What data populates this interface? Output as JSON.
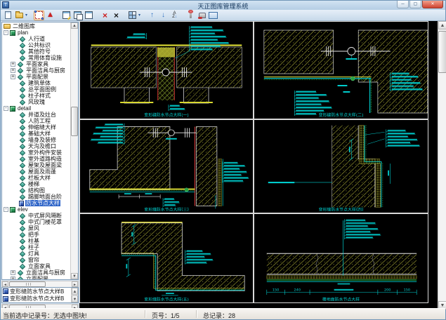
{
  "window": {
    "title": "天正图库管理系统"
  },
  "toolbar": {
    "items": [
      {
        "name": "new-library-button",
        "type": "page"
      },
      {
        "name": "open-library-button",
        "type": "folder",
        "dropdown": true
      },
      {
        "name": "select-mode-button",
        "type": "select",
        "active": true,
        "gap": true
      },
      {
        "name": "multi-view-button",
        "type": "pyramid"
      },
      {
        "name": "rename-block-button",
        "type": "panel-edit",
        "gap": true
      },
      {
        "name": "copy-block-button",
        "type": "panel-copy"
      },
      {
        "name": "move-block-button",
        "type": "panel-move"
      },
      {
        "name": "delete-record-button",
        "type": "delete-red",
        "gap": true
      },
      {
        "name": "delete-category-button",
        "type": "delete-black"
      },
      {
        "name": "layout-grid-button",
        "type": "grid",
        "dropdown": true,
        "gap": true
      },
      {
        "name": "page-up-button",
        "type": "arrow-up",
        "glyph": "↑",
        "gap": true
      },
      {
        "name": "page-down-button",
        "type": "arrow-down",
        "glyph": "↓"
      },
      {
        "name": "sort-button",
        "type": "sort"
      },
      {
        "name": "pin-button",
        "type": "pin",
        "gap": true
      },
      {
        "name": "stamp-button",
        "type": "stamp"
      },
      {
        "name": "view-panel-button",
        "type": "image"
      }
    ]
  },
  "sidebar": {
    "tree": [
      {
        "label": "二维图库",
        "kind": "root"
      },
      {
        "label": "plan",
        "kind": "group"
      },
      {
        "label": "人行道",
        "kind": "leaf"
      },
      {
        "label": "公共标识",
        "kind": "leaf"
      },
      {
        "label": "其他符号",
        "kind": "leaf"
      },
      {
        "label": "常用体育设施",
        "kind": "leaf"
      },
      {
        "label": "平面家具",
        "kind": "leafx"
      },
      {
        "label": "平面洁具与厨房",
        "kind": "leafx"
      },
      {
        "label": "平面配景",
        "kind": "leafx"
      },
      {
        "label": "建筑单体",
        "kind": "leaf"
      },
      {
        "label": "总平面图例",
        "kind": "leaf"
      },
      {
        "label": "柱子样式",
        "kind": "leaf"
      },
      {
        "label": "风玫瑰",
        "kind": "leaf"
      },
      {
        "label": "detail",
        "kind": "group"
      },
      {
        "label": "井道及灶台",
        "kind": "leaf"
      },
      {
        "label": "人防工程",
        "kind": "leaf"
      },
      {
        "label": "伸缩缝大样",
        "kind": "leaf"
      },
      {
        "label": "基础大样",
        "kind": "leaf"
      },
      {
        "label": "墙身及装修",
        "kind": "leaf"
      },
      {
        "label": "天沟及檐口",
        "kind": "leaf"
      },
      {
        "label": "室外构件安装",
        "kind": "leaf"
      },
      {
        "label": "室外道路构造",
        "kind": "leaf"
      },
      {
        "label": "屋架及屋面梁",
        "kind": "leaf"
      },
      {
        "label": "屋面及雨蓬",
        "kind": "leaf"
      },
      {
        "label": "栏板大样",
        "kind": "leaf"
      },
      {
        "label": "楼梯",
        "kind": "leaf"
      },
      {
        "label": "结构图",
        "kind": "leaf"
      },
      {
        "label": "踢脚地面台阶",
        "kind": "leaf"
      },
      {
        "label": "防水节点大样",
        "kind": "leaf",
        "selected": true
      },
      {
        "label": "elev",
        "kind": "group"
      },
      {
        "label": "中式屏风隔断",
        "kind": "leaf"
      },
      {
        "label": "中式门楼花罩",
        "kind": "leaf"
      },
      {
        "label": "屏风",
        "kind": "leaf"
      },
      {
        "label": "把手",
        "kind": "leaf"
      },
      {
        "label": "柱基",
        "kind": "leaf"
      },
      {
        "label": "柱子",
        "kind": "leaf"
      },
      {
        "label": "灯具",
        "kind": "leaf"
      },
      {
        "label": "窗帘",
        "kind": "leaf"
      },
      {
        "label": "立面家具",
        "kind": "leaf"
      },
      {
        "label": "立面洁具与厨房",
        "kind": "leafx"
      },
      {
        "label": "立面配景",
        "kind": "leafx"
      }
    ]
  },
  "listbox": {
    "items": [
      "变形缝防水节点大样B",
      "变形缝防水节点大样B"
    ]
  },
  "statusbar": {
    "selection": "当前选中记录号：无选中图块!",
    "page": "页号：1/5",
    "total": "总记录：28"
  },
  "panels": {
    "captions": [
      "变形缝防水节点大样(一)",
      "变形缝防水节点大样(二)",
      "变形缝防水节点大样(三)",
      "变形缝防水节点大样(四)",
      "变形缝防水节点大样(五)",
      "楼地面防水节点大样"
    ],
    "p6_dims": [
      "150",
      "240",
      "200",
      "150"
    ]
  },
  "colors": {
    "titlebar": "#c3d8ea",
    "toolbar": "#d7e5f2",
    "selection": "#2e64c8",
    "cad_yellow": "#b8b832",
    "cad_cyan": "#00d4d4",
    "cad_green": "#28b848",
    "cad_red": "#c03030"
  }
}
